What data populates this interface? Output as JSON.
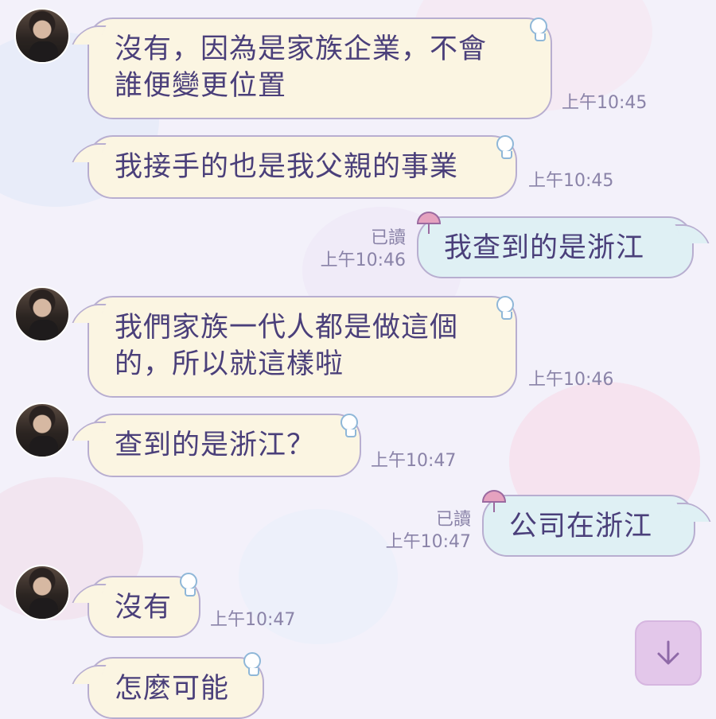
{
  "messages": [
    {
      "side": "in",
      "text": "沒有，因為是家族企業，不會\n誰便變更位置",
      "time": "上午10:45"
    },
    {
      "side": "in",
      "text": "我接手的也是我父親的事業",
      "time": "上午10:45"
    },
    {
      "side": "out",
      "text": "我查到的是浙江",
      "read": "已讀",
      "time": "上午10:46"
    },
    {
      "side": "in",
      "text": "我們家族一代人都是做這個\n的，所以就這樣啦",
      "time": "上午10:46"
    },
    {
      "side": "in",
      "text": "查到的是浙江？",
      "time": "上午10:47"
    },
    {
      "side": "out",
      "text": "公司在浙江",
      "read": "已讀",
      "time": "上午10:47"
    },
    {
      "side": "in",
      "text": "沒有",
      "time": "上午10:47"
    },
    {
      "side": "in",
      "text": "怎麼可能",
      "time": ""
    }
  ],
  "scroll_down": {
    "icon": "arrow-down-icon"
  },
  "colors": {
    "incoming_bubble": "#fbf5e2",
    "outgoing_bubble": "#dff0f4",
    "bubble_text": "#4a3f7a",
    "timestamp": "#8a83a8",
    "scroll_button": "#e3c7ea"
  }
}
